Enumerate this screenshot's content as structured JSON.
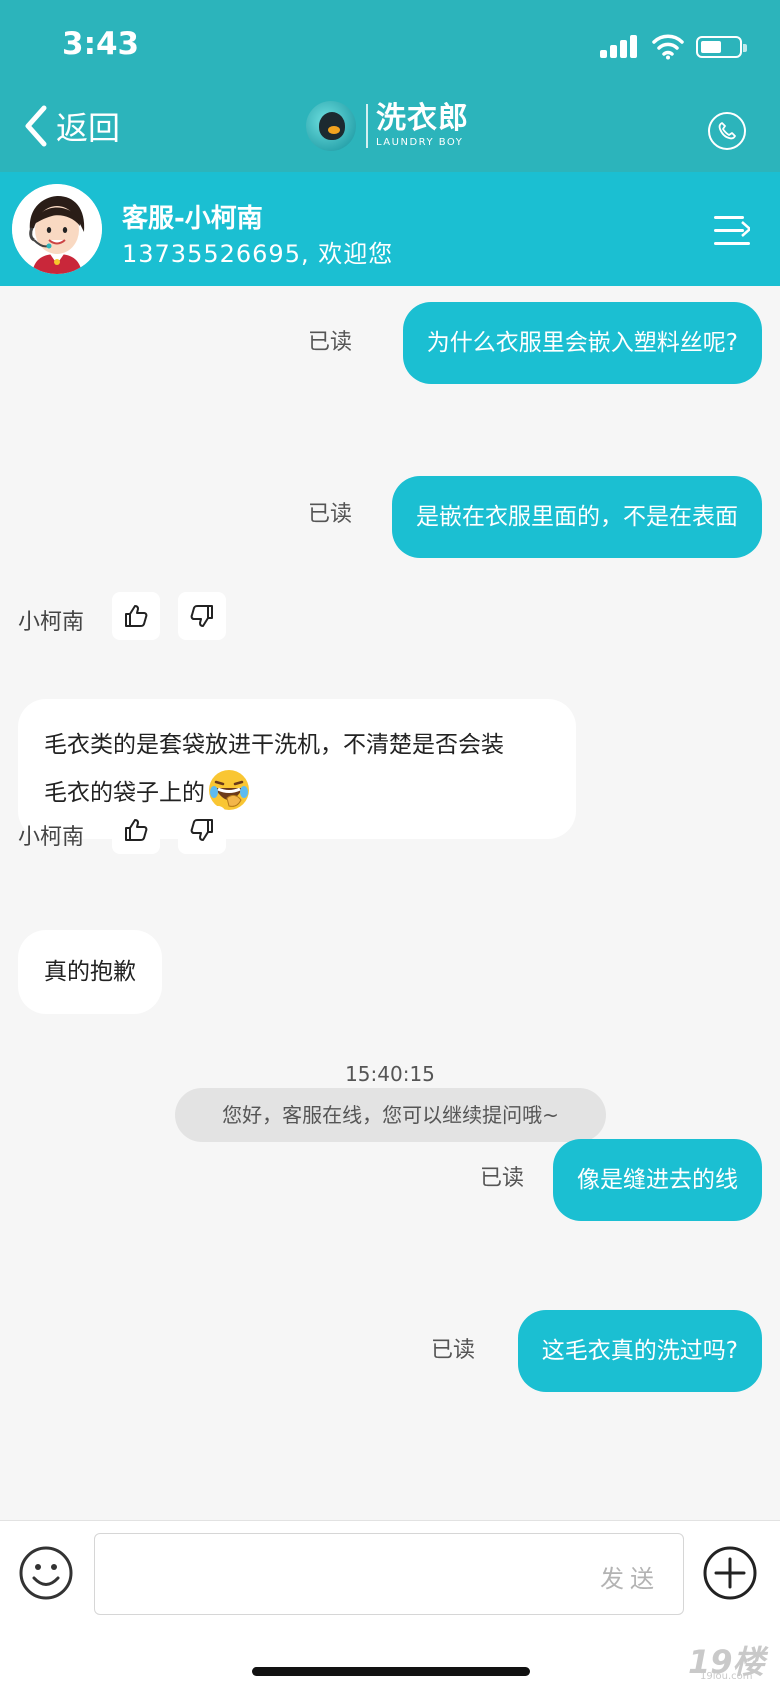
{
  "status_bar": {
    "time": "3:43"
  },
  "nav": {
    "back_label": "返回",
    "brand_cn": "洗衣郎",
    "brand_en": "LAUNDRY BOY",
    "phone_icon": "phone-icon"
  },
  "agent": {
    "name": "客服-小柯南",
    "subtitle": "13735526695, 欢迎您",
    "menu_icon": "list-menu-icon"
  },
  "messages": [
    {
      "type": "outgoing",
      "text": "为什么衣服里会嵌入塑料丝呢?",
      "status": "已读"
    },
    {
      "type": "outgoing",
      "text": "是嵌在衣服里面的，不是在表面",
      "status": "已读"
    },
    {
      "type": "incoming",
      "sender": "小柯南",
      "line1": "毛衣类的是套袋放进干洗机，不清楚是否会装",
      "line2": "毛衣的袋子上的",
      "emoji": "laughing-crying-emoji"
    },
    {
      "type": "incoming",
      "sender": "小柯南",
      "text": "真的抱歉"
    },
    {
      "type": "system",
      "time": "15:40:15",
      "text": "您好，客服在线，您可以继续提问哦~"
    },
    {
      "type": "outgoing",
      "text": "像是缝进去的线",
      "status": "已读"
    },
    {
      "type": "outgoing",
      "text": "这毛衣真的洗过吗?",
      "status": "已读"
    }
  ],
  "input": {
    "placeholder": "",
    "value": "",
    "send_label": "发送"
  },
  "watermark": {
    "text": "19楼",
    "sub": "19lou.com"
  },
  "colors": {
    "nav_teal": "#2cb4bb",
    "agent_bar": "#1bbfd2",
    "outgoing_bubble": "#1bbfd2",
    "background": "#f6f6f6"
  }
}
